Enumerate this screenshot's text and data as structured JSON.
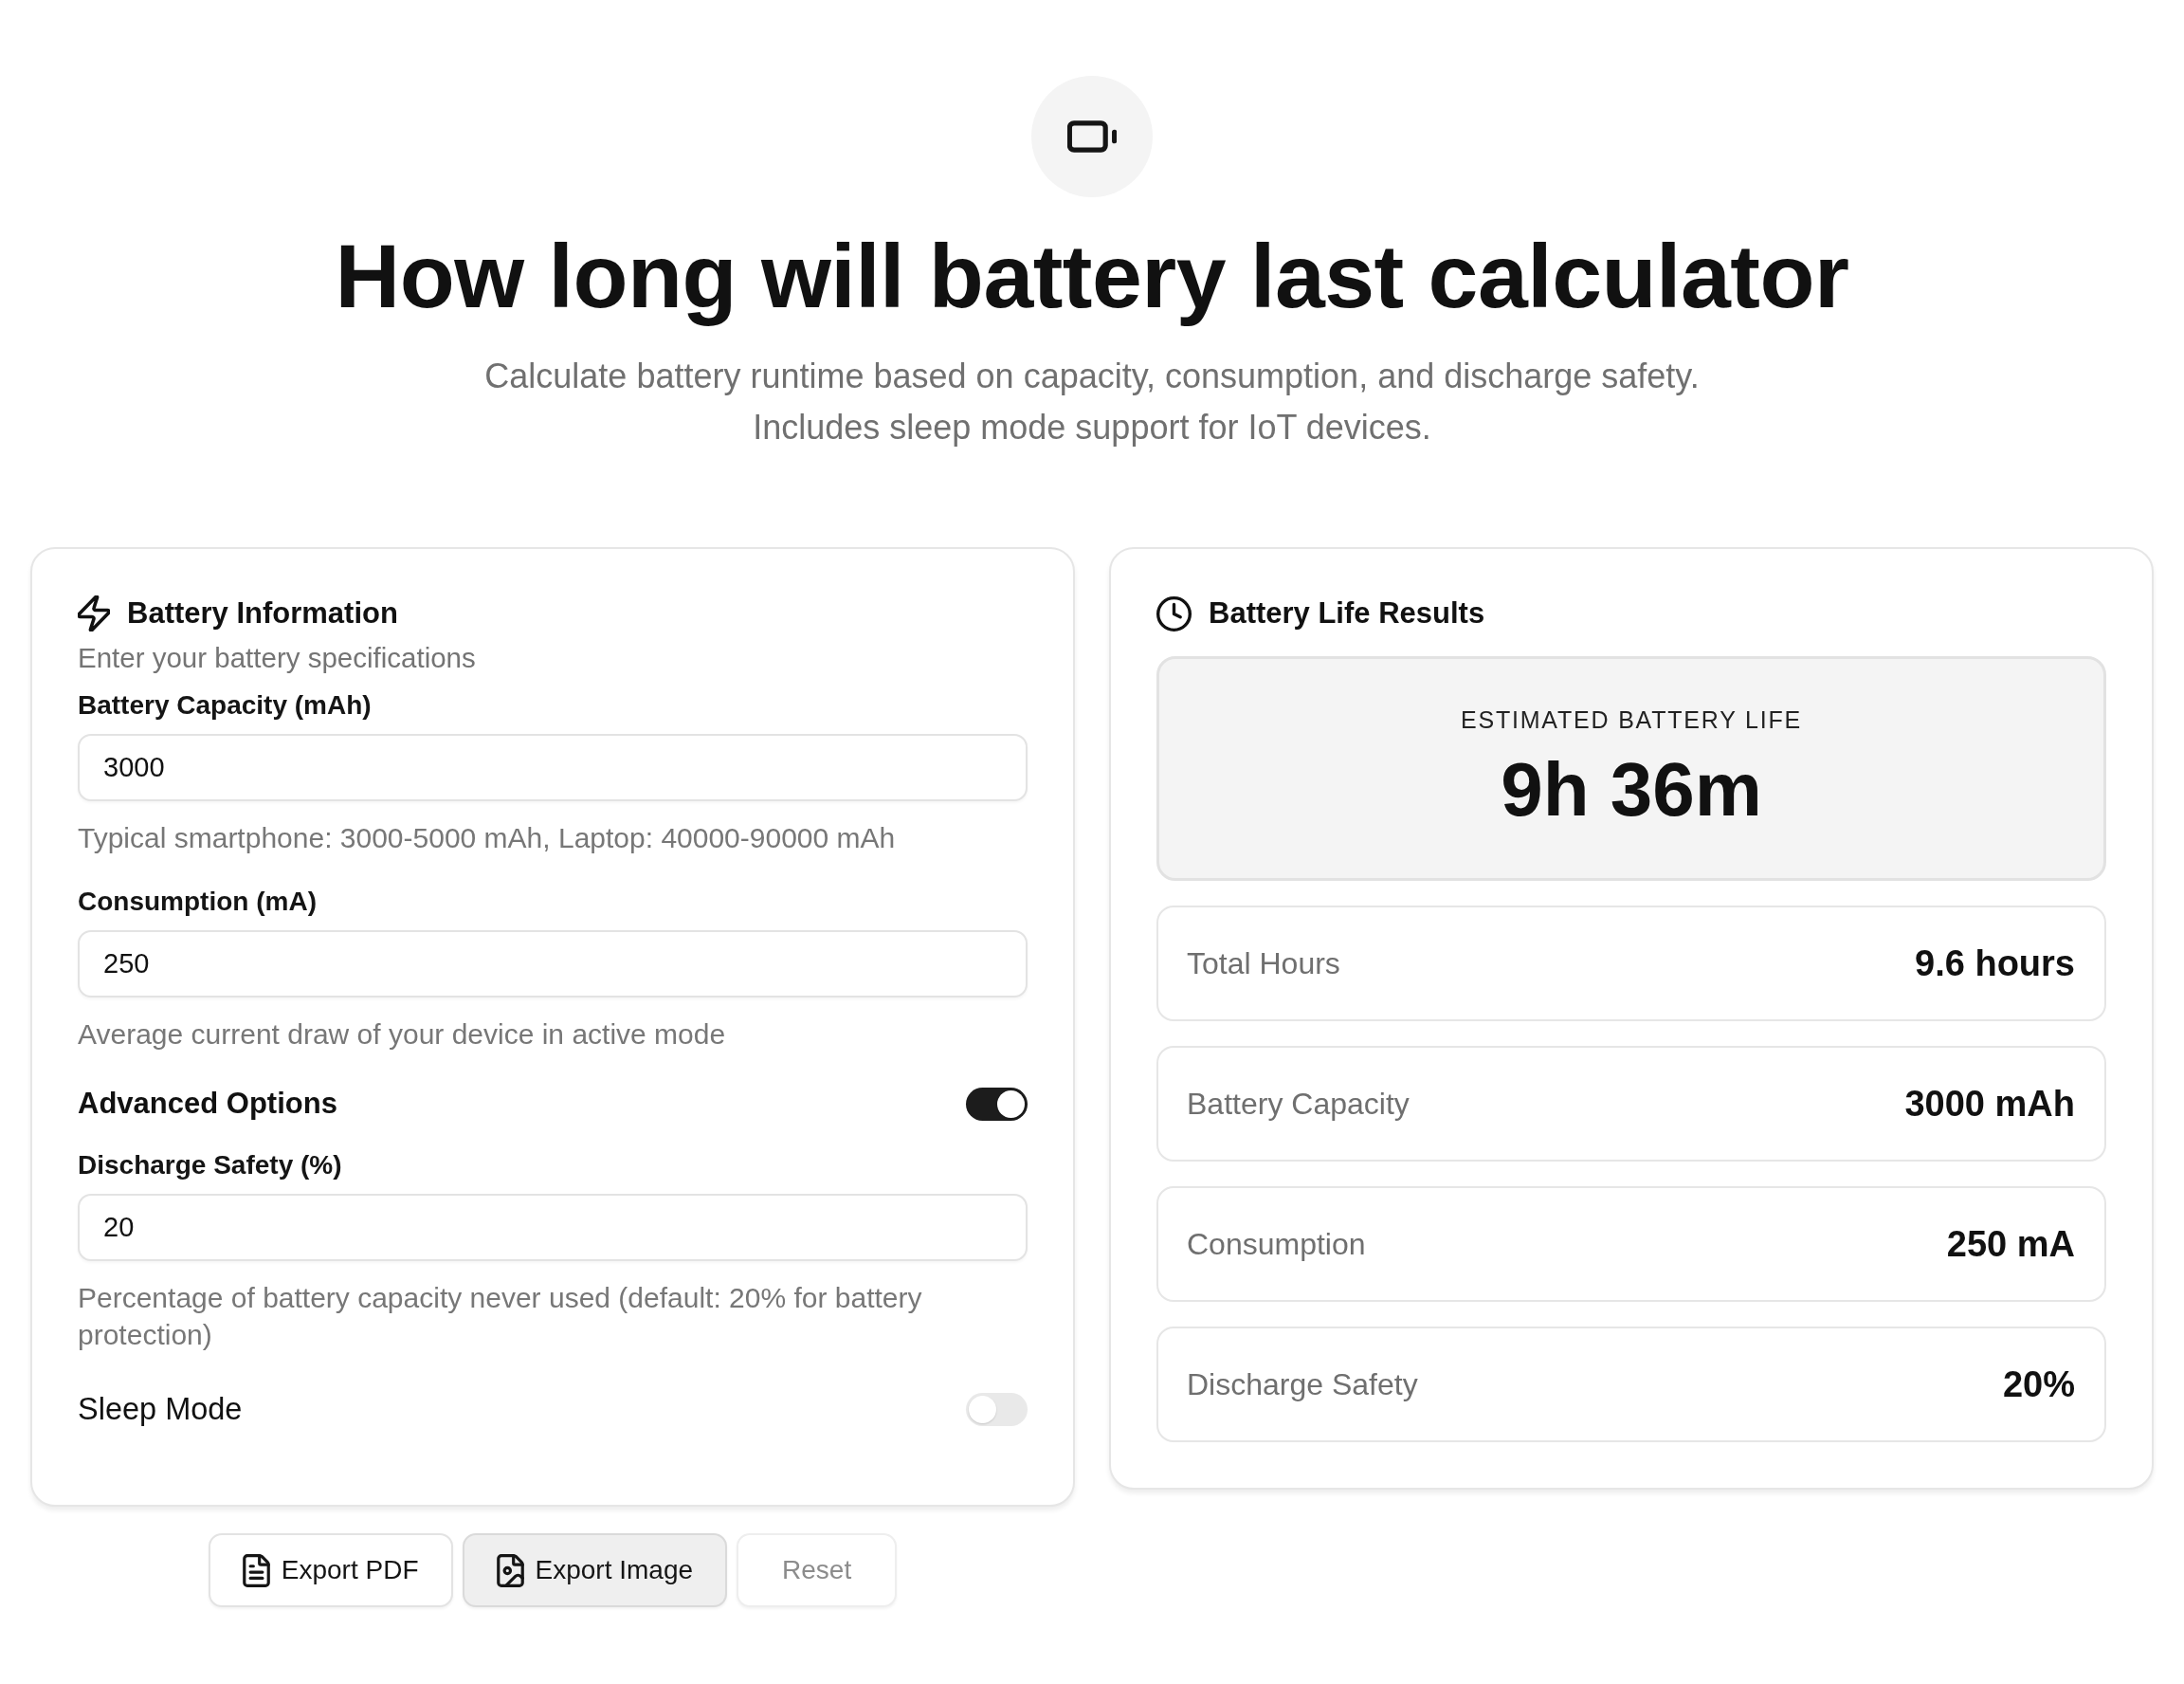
{
  "hero": {
    "title": "How long will battery last calculator",
    "subtitle_lines": [
      "Calculate battery runtime based on capacity, consumption, and discharge safety.",
      "Includes sleep mode support for IoT devices."
    ]
  },
  "input_card": {
    "title": "Battery Information",
    "description": "Enter your battery specifications",
    "fields": [
      {
        "label": "Battery Capacity (mAh)",
        "value": "3000",
        "hint": "Typical smartphone: 3000-5000 mAh, Laptop: 40000-90000 mAh"
      },
      {
        "label": "Consumption (mA)",
        "value": "250",
        "hint": "Average current draw of your device in active mode"
      }
    ],
    "advanced_options": {
      "label": "Advanced Options",
      "on": true,
      "fields": [
        {
          "label": "Discharge Safety (%)",
          "value": "20",
          "hint": "Percentage of battery capacity never used (default: 20% for battery protection)"
        }
      ]
    },
    "sleep_mode": {
      "label": "Sleep Mode",
      "on": false
    }
  },
  "actions": [
    {
      "kind": "pdf",
      "label": "Export PDF",
      "highlighted": false,
      "disabled": false
    },
    {
      "kind": "image",
      "label": "Export Image",
      "highlighted": true,
      "disabled": false
    },
    {
      "kind": "reset",
      "label": "Reset",
      "highlighted": false,
      "disabled": true
    }
  ],
  "results_card": {
    "title": "Battery Life Results",
    "estimate": {
      "label": "ESTIMATED BATTERY LIFE",
      "value": "9h 36m"
    },
    "stats": [
      {
        "label": "Total Hours",
        "value": "9.6 hours"
      },
      {
        "label": "Battery Capacity",
        "value": "3000 mAh"
      },
      {
        "label": "Consumption",
        "value": "250 mA"
      },
      {
        "label": "Discharge Safety",
        "value": "20%"
      }
    ]
  }
}
